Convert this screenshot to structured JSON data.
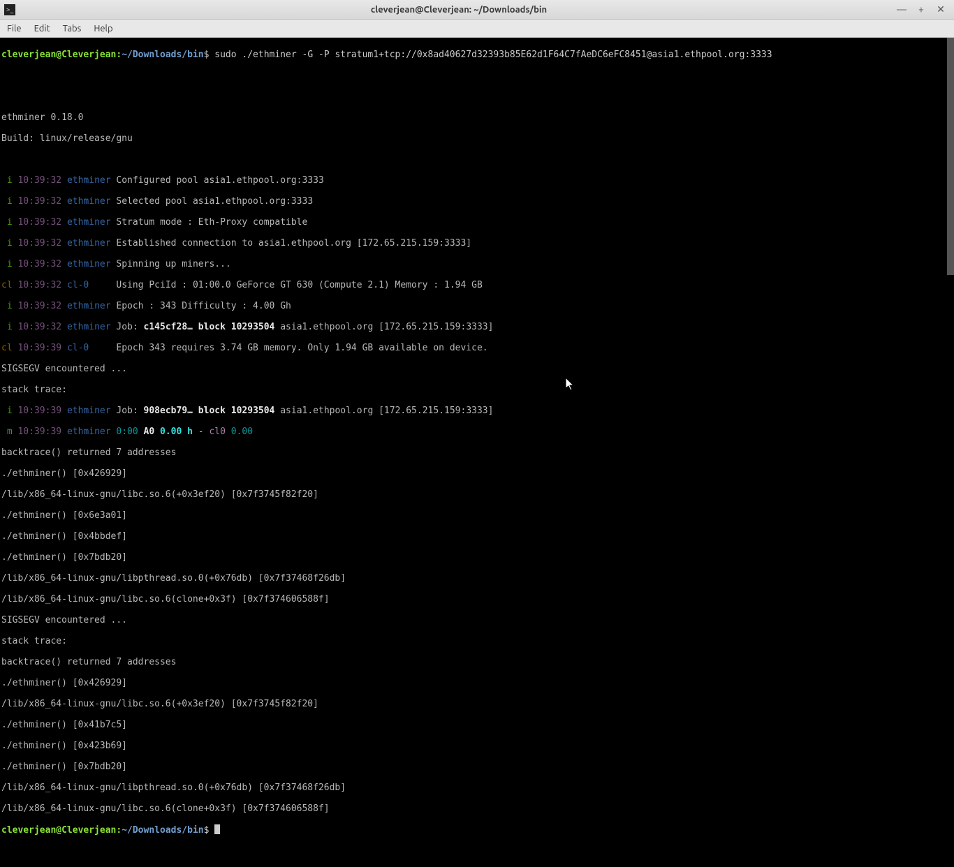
{
  "titlebar": {
    "title": "cleverjean@Cleverjean: ~/Downloads/bin"
  },
  "menubar": {
    "file": "File",
    "edit": "Edit",
    "tabs": "Tabs",
    "help": "Help"
  },
  "prompt": {
    "user": "cleverjean@Cleverjean",
    "colon": ":",
    "path": "~/Downloads/bin",
    "dollar": "$"
  },
  "command": "sudo ./ethminer -G -P stratum1+tcp://0x8ad40627d32393b85E62d1F64C7fAeDC6eFC8451@asia1.ethpool.org:3333",
  "header": {
    "l1": "ethminer 0.18.0",
    "l2": "Build: linux/release/gnu"
  },
  "log": [
    {
      "tag": " i",
      "ts": "10:39:32",
      "comp": "ethminer",
      "msg": "Configured pool asia1.ethpool.org:3333"
    },
    {
      "tag": " i",
      "ts": "10:39:32",
      "comp": "ethminer",
      "msg": "Selected pool asia1.ethpool.org:3333"
    },
    {
      "tag": " i",
      "ts": "10:39:32",
      "comp": "ethminer",
      "msg": "Stratum mode : Eth-Proxy compatible"
    },
    {
      "tag": " i",
      "ts": "10:39:32",
      "comp": "ethminer",
      "msg": "Established connection to asia1.ethpool.org [172.65.215.159:3333]"
    },
    {
      "tag": " i",
      "ts": "10:39:32",
      "comp": "ethminer",
      "msg": "Spinning up miners..."
    },
    {
      "tag": "cl",
      "ts": "10:39:32",
      "comp": "cl-0    ",
      "msg": "Using PciId : 01:00.0 GeForce GT 630 (Compute 2.1) Memory : 1.94 GB"
    },
    {
      "tag": " i",
      "ts": "10:39:32",
      "comp": "ethminer",
      "msg": "Epoch : 343 Difficulty : 4.00 Gh"
    }
  ],
  "job1": {
    "tag": " i",
    "ts": "10:39:32",
    "comp": "ethminer",
    "prefix": "Job: ",
    "hash": "c145cf28…",
    "block": " block 10293504",
    "rest": " asia1.ethpool.org [172.65.215.159:3333]"
  },
  "clreq": {
    "tag": "cl",
    "ts": "10:39:39",
    "comp": "cl-0    ",
    "msg": "Epoch 343 requires 3.74 GB memory. Only 1.94 GB available on device."
  },
  "seg1": "SIGSEGV encountered ...",
  "st1": "stack trace:",
  "job2": {
    "tag": " i",
    "ts": "10:39:39",
    "comp": "ethminer",
    "prefix": "Job: ",
    "hash": "908ecb79…",
    "block": " block 10293504",
    "rest": " asia1.ethpool.org [172.65.215.159:3333]"
  },
  "mline": {
    "tag": " m",
    "ts": "10:39:39",
    "comp": "ethminer",
    "t1": "0:00",
    "a": " A0",
    "rate": " 0.00 h",
    "dash": " - ",
    "cl": "cl0",
    "v2": " 0.00"
  },
  "bt1": [
    "backtrace() returned 7 addresses",
    "./ethminer() [0x426929]",
    "/lib/x86_64-linux-gnu/libc.so.6(+0x3ef20) [0x7f3745f82f20]",
    "./ethminer() [0x6e3a01]",
    "./ethminer() [0x4bbdef]",
    "./ethminer() [0x7bdb20]",
    "/lib/x86_64-linux-gnu/libpthread.so.0(+0x76db) [0x7f37468f26db]",
    "/lib/x86_64-linux-gnu/libc.so.6(clone+0x3f) [0x7f374606588f]"
  ],
  "seg2": "SIGSEGV encountered ...",
  "st2": "stack trace:",
  "bt2": [
    "backtrace() returned 7 addresses",
    "./ethminer() [0x426929]",
    "/lib/x86_64-linux-gnu/libc.so.6(+0x3ef20) [0x7f3745f82f20]",
    "./ethminer() [0x41b7c5]",
    "./ethminer() [0x423b69]",
    "./ethminer() [0x7bdb20]",
    "/lib/x86_64-linux-gnu/libpthread.so.0(+0x76db) [0x7f37468f26db]",
    "/lib/x86_64-linux-gnu/libc.so.6(clone+0x3f) [0x7f374606588f]"
  ]
}
